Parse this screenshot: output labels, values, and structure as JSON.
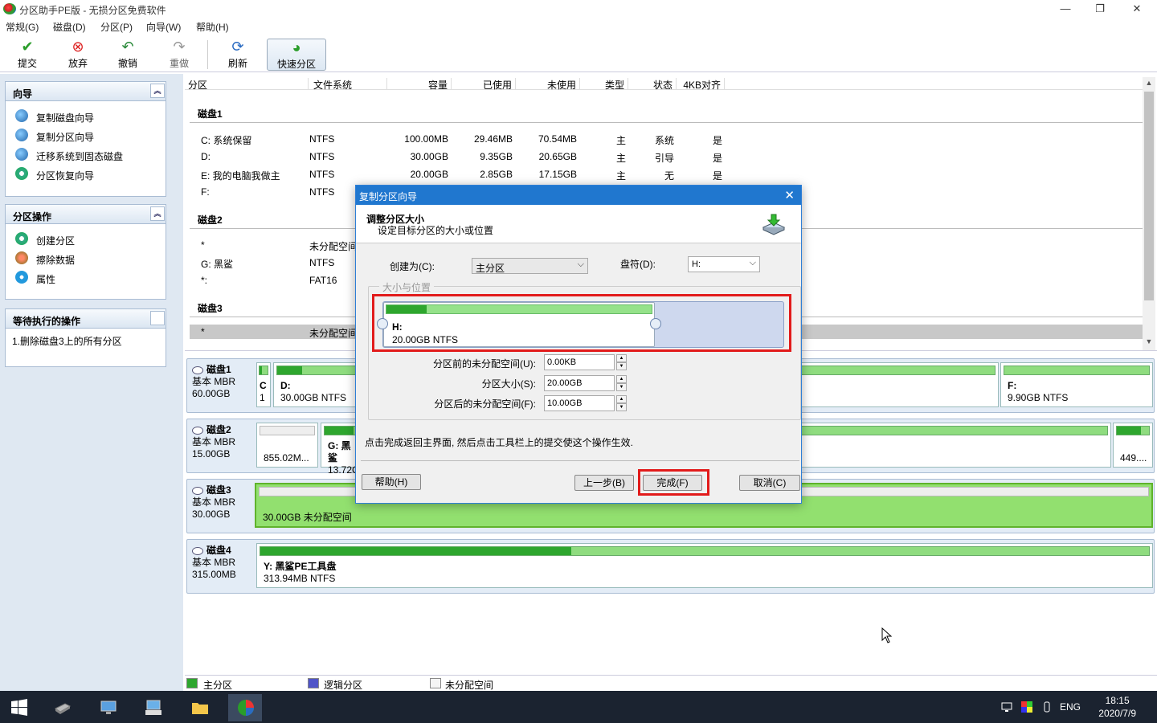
{
  "window": {
    "title": "分区助手PE版 - 无损分区免费软件",
    "min": "—",
    "max": "❐",
    "close": "✕"
  },
  "menu": [
    "常规(G)",
    "磁盘(D)",
    "分区(P)",
    "向导(W)",
    "帮助(H)"
  ],
  "toolbar": {
    "commit": "提交",
    "discard": "放弃",
    "undo": "撤销",
    "redo": "重做",
    "refresh": "刷新",
    "quick": "快速分区"
  },
  "panels": {
    "wizard": {
      "title": "向导",
      "items": [
        "复制磁盘向导",
        "复制分区向导",
        "迁移系统到固态磁盘",
        "分区恢复向导"
      ]
    },
    "partops": {
      "title": "分区操作",
      "items": [
        "创建分区",
        "擦除数据",
        "属性"
      ]
    },
    "pending": {
      "title": "等待执行的操作",
      "items": [
        "1.删除磁盘3上的所有分区"
      ]
    }
  },
  "list": {
    "headers": [
      "分区",
      "文件系统",
      "容量",
      "已使用",
      "未使用",
      "类型",
      "状态",
      "4KB对齐"
    ],
    "disk1": "磁盘1",
    "disk2": "磁盘2",
    "disk3": "磁盘3",
    "rows1": [
      [
        "C: 系统保留",
        "NTFS",
        "100.00MB",
        "29.46MB",
        "70.54MB",
        "主",
        "系统",
        "是"
      ],
      [
        "D:",
        "NTFS",
        "30.00GB",
        "9.35GB",
        "20.65GB",
        "主",
        "引导",
        "是"
      ],
      [
        "E: 我的电脑我做主",
        "NTFS",
        "20.00GB",
        "2.85GB",
        "17.15GB",
        "主",
        "无",
        "是"
      ],
      [
        "F:",
        "NTFS"
      ]
    ],
    "rows2": [
      [
        "*",
        "未分配空间"
      ],
      [
        "G: 黑鲨",
        "NTFS"
      ],
      [
        "*:",
        "FAT16"
      ]
    ],
    "rows3": [
      [
        "*",
        "未分配空间"
      ]
    ]
  },
  "diskmap": {
    "d1": {
      "name": "磁盘1",
      "type": "基本 MBR",
      "size": "60.00GB",
      "c": "C",
      "c1": "1",
      "d_name": "D:",
      "d_info": "30.00GB NTFS",
      "f_name": "F:",
      "f_info": "9.90GB NTFS"
    },
    "d2": {
      "name": "磁盘2",
      "type": "基本 MBR",
      "size": "15.00GB",
      "p1": "855.02M...",
      "g_name": "G: 黑鲨",
      "g_info": "13.72G",
      "p4": "449...."
    },
    "d3": {
      "name": "磁盘3",
      "type": "基本 MBR",
      "size": "30.00GB",
      "info": "30.00GB 未分配空间"
    },
    "d4": {
      "name": "磁盘4",
      "type": "基本 MBR",
      "size": "315.00MB",
      "y_name": "Y: 黑鲨PE工具盘",
      "y_info": "313.94MB NTFS",
      "y_used": 0.35
    }
  },
  "legend": {
    "primary": "主分区",
    "logical": "逻辑分区",
    "unalloc": "未分配空间"
  },
  "dialog": {
    "title": "复制分区向导",
    "heading": "调整分区大小",
    "subheading": "设定目标分区的大小或位置",
    "create_label": "创建为(C):",
    "create_value": "主分区",
    "drive_label": "盘符(D):",
    "drive_value": "H:",
    "group": "大小与位置",
    "part_name": "H:",
    "part_info": "20.00GB NTFS",
    "before_label": "分区前的未分配空间(U):",
    "before_value": "0.00KB",
    "size_label": "分区大小(S):",
    "size_value": "20.00GB",
    "after_label": "分区后的未分配空间(F):",
    "after_value": "10.00GB",
    "notice": "点击完成返回主界面, 然后点击工具栏上的提交使这个操作生效.",
    "help": "帮助(H)",
    "back": "上一步(B)",
    "finish": "完成(F)",
    "cancel": "取消(C)"
  },
  "taskbar": {
    "lang": "ENG",
    "time": "18:15",
    "date": "2020/7/9"
  },
  "colors": {
    "accent": "#2077cf",
    "primary_green": "#2ea62e",
    "highlight_red": "#e21b1b"
  }
}
